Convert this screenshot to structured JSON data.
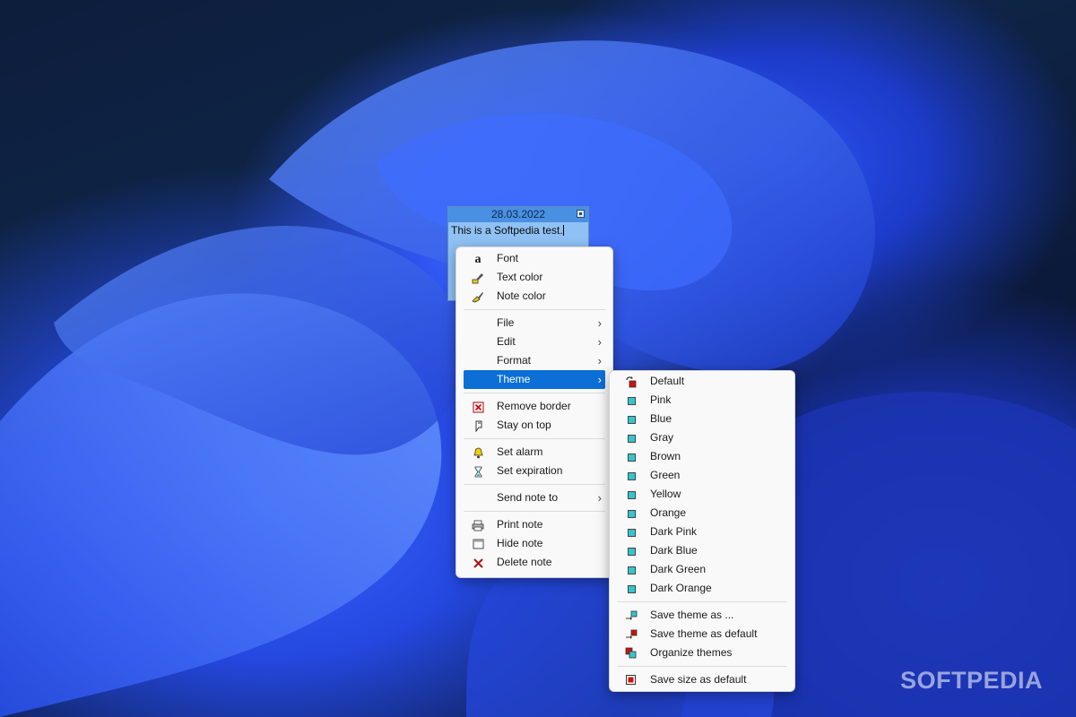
{
  "note": {
    "date": "28.03.2022",
    "text": "This is a Softpedia test."
  },
  "main_menu": {
    "items": [
      {
        "label": "Font"
      },
      {
        "label": "Text color"
      },
      {
        "label": "Note color"
      },
      {
        "label": "File"
      },
      {
        "label": "Edit"
      },
      {
        "label": "Format"
      },
      {
        "label": "Theme"
      },
      {
        "label": "Remove border"
      },
      {
        "label": "Stay on top"
      },
      {
        "label": "Set alarm"
      },
      {
        "label": "Set expiration"
      },
      {
        "label": "Send note to"
      },
      {
        "label": "Print note"
      },
      {
        "label": "Hide note"
      },
      {
        "label": "Delete note"
      }
    ]
  },
  "theme_menu": {
    "items": [
      {
        "label": "Default"
      },
      {
        "label": "Pink"
      },
      {
        "label": "Blue"
      },
      {
        "label": "Gray"
      },
      {
        "label": "Brown"
      },
      {
        "label": "Green"
      },
      {
        "label": "Yellow"
      },
      {
        "label": "Orange"
      },
      {
        "label": "Dark Pink"
      },
      {
        "label": "Dark Blue"
      },
      {
        "label": "Dark Green"
      },
      {
        "label": "Dark Orange"
      },
      {
        "label": "Save theme as ..."
      },
      {
        "label": "Save theme as default"
      },
      {
        "label": "Organize themes"
      },
      {
        "label": "Save size as default"
      }
    ]
  },
  "watermark": "SOFTPEDIA",
  "colors": {
    "highlight": "#0b6fd6",
    "note_background": "#8fc1f4",
    "note_titlebar": "#4a90e2",
    "theme_swatch": "#33c6cc"
  }
}
